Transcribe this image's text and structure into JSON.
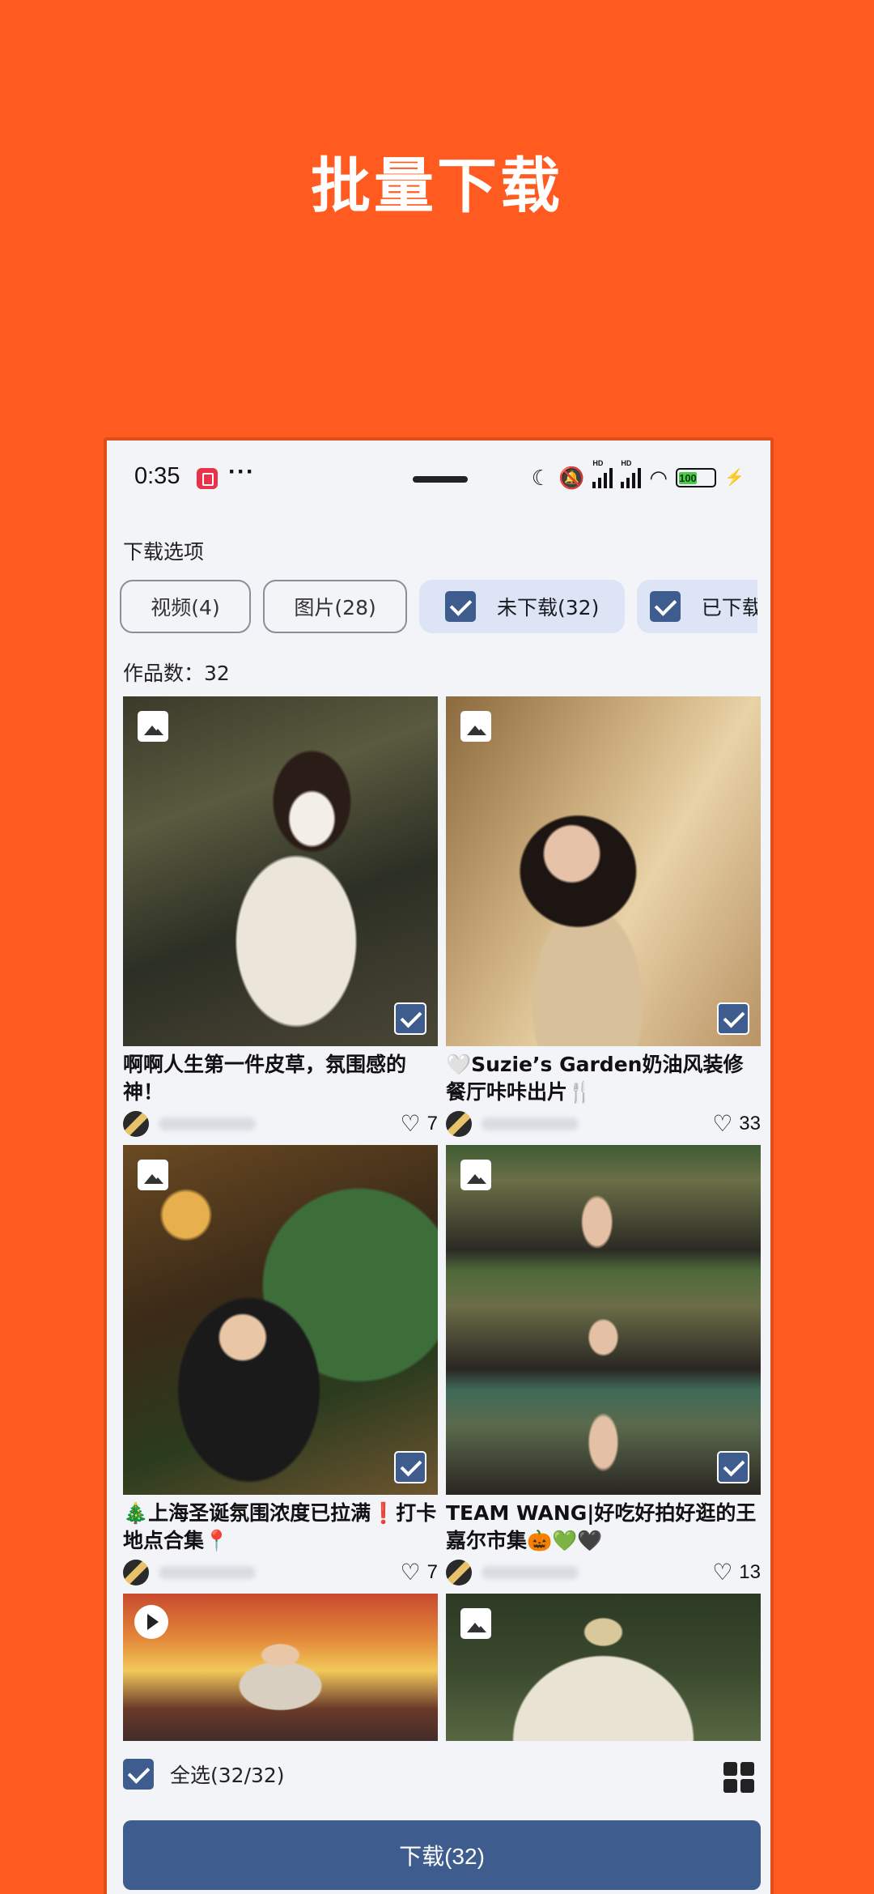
{
  "promo": {
    "title": "批量下载"
  },
  "statusbar": {
    "time": "0:35",
    "more": "···",
    "icons": [
      "moon-icon",
      "mute-icon",
      "hd-signal-icon",
      "hd-signal-icon",
      "wifi-icon",
      "battery-icon",
      "charging-icon"
    ],
    "battery": "100"
  },
  "options": {
    "label": "下载选项",
    "chips": [
      {
        "label": "视频(4)",
        "checked": false
      },
      {
        "label": "图片(28)",
        "checked": false
      },
      {
        "label": "未下载(32)",
        "checked": true
      },
      {
        "label": "已下载",
        "checked": true
      }
    ]
  },
  "works": {
    "count_label": "作品数：32",
    "items": [
      {
        "type": "image",
        "title": "啊啊人生第一件皮草，氛围感的神！",
        "likes": "7",
        "selected": true
      },
      {
        "type": "image",
        "title": "🤍Suzie’s Garden奶油风装修餐厅咔咔出片🍴",
        "likes": "33",
        "selected": true
      },
      {
        "type": "image",
        "title": "🎄上海圣诞氛围浓度已拉满❗打卡地点合集📍",
        "likes": "7",
        "selected": true
      },
      {
        "type": "image",
        "title": "TEAM WANG|好吃好拍好逛的王嘉尔市集🎃💚🖤",
        "likes": "13",
        "selected": true
      },
      {
        "type": "video",
        "title": "",
        "likes": "",
        "selected": true
      },
      {
        "type": "image",
        "title": "",
        "likes": "",
        "selected": true
      }
    ]
  },
  "bottom": {
    "select_all": "全选(32/32)",
    "download": "下载(32)"
  },
  "colors": {
    "accent": "#3E5C8E",
    "promo_bg": "#FF5A1F"
  }
}
